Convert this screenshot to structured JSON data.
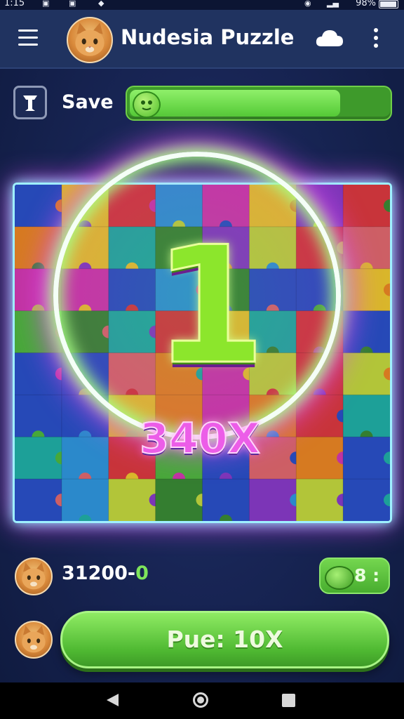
{
  "status_bar": {
    "time": "1:15",
    "battery": "98%"
  },
  "app_bar": {
    "title": "Nudesia Puzzle"
  },
  "save": {
    "label": "Save",
    "progress_fraction": 0.82
  },
  "board": {
    "big_number": "1",
    "multiplier": "340X"
  },
  "score": {
    "value": "31200-",
    "zero": "0"
  },
  "lives": {
    "label": "8 :"
  },
  "play_button": {
    "label": "Pue: 10X"
  },
  "colors": {
    "accent_green": "#5cc93a",
    "background": "#182555",
    "magenta_glow": "#e14cf2"
  },
  "icons": {
    "menu": "hamburger-icon",
    "cloud": "cloud-icon",
    "more": "more-vertical-icon",
    "save": "save-icon",
    "nav": [
      "back-icon",
      "home-icon",
      "recent-apps-icon"
    ]
  }
}
